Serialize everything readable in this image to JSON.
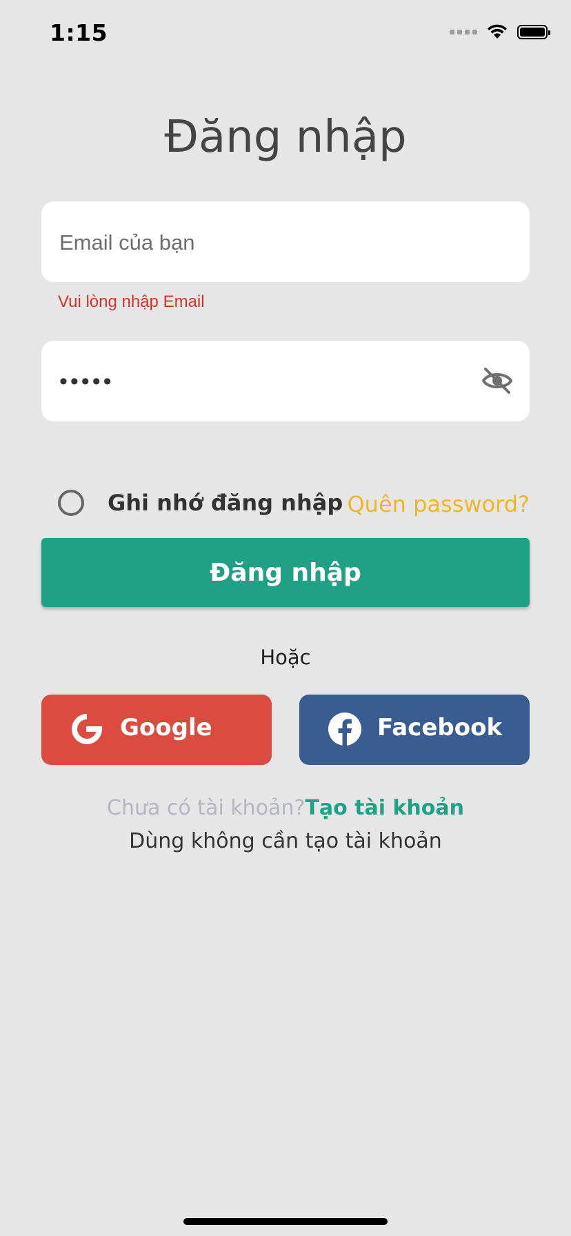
{
  "status_bar": {
    "time": "1:15"
  },
  "title": "Đăng nhập",
  "email_field": {
    "placeholder": "Email của bạn",
    "value": ""
  },
  "email_error": "Vui lòng nhập Email",
  "password_field": {
    "value": "•••••"
  },
  "remember": {
    "label": "Ghi nhớ đăng nhập",
    "checked": false
  },
  "forgot_label": "Quên password?",
  "login_button": "Đăng nhập",
  "or_label": "Hoặc",
  "google_button": "Google",
  "facebook_button": "Facebook",
  "no_account": "Chưa có tài khoản?",
  "create_account": "Tạo tài khoản",
  "guest_label": "Dùng không cần tạo tài khoản",
  "colors": {
    "accent": "#20a084",
    "google": "#db4b3f",
    "facebook": "#3a5d91",
    "forgot": "#f0b428",
    "error": "#d0342c"
  }
}
